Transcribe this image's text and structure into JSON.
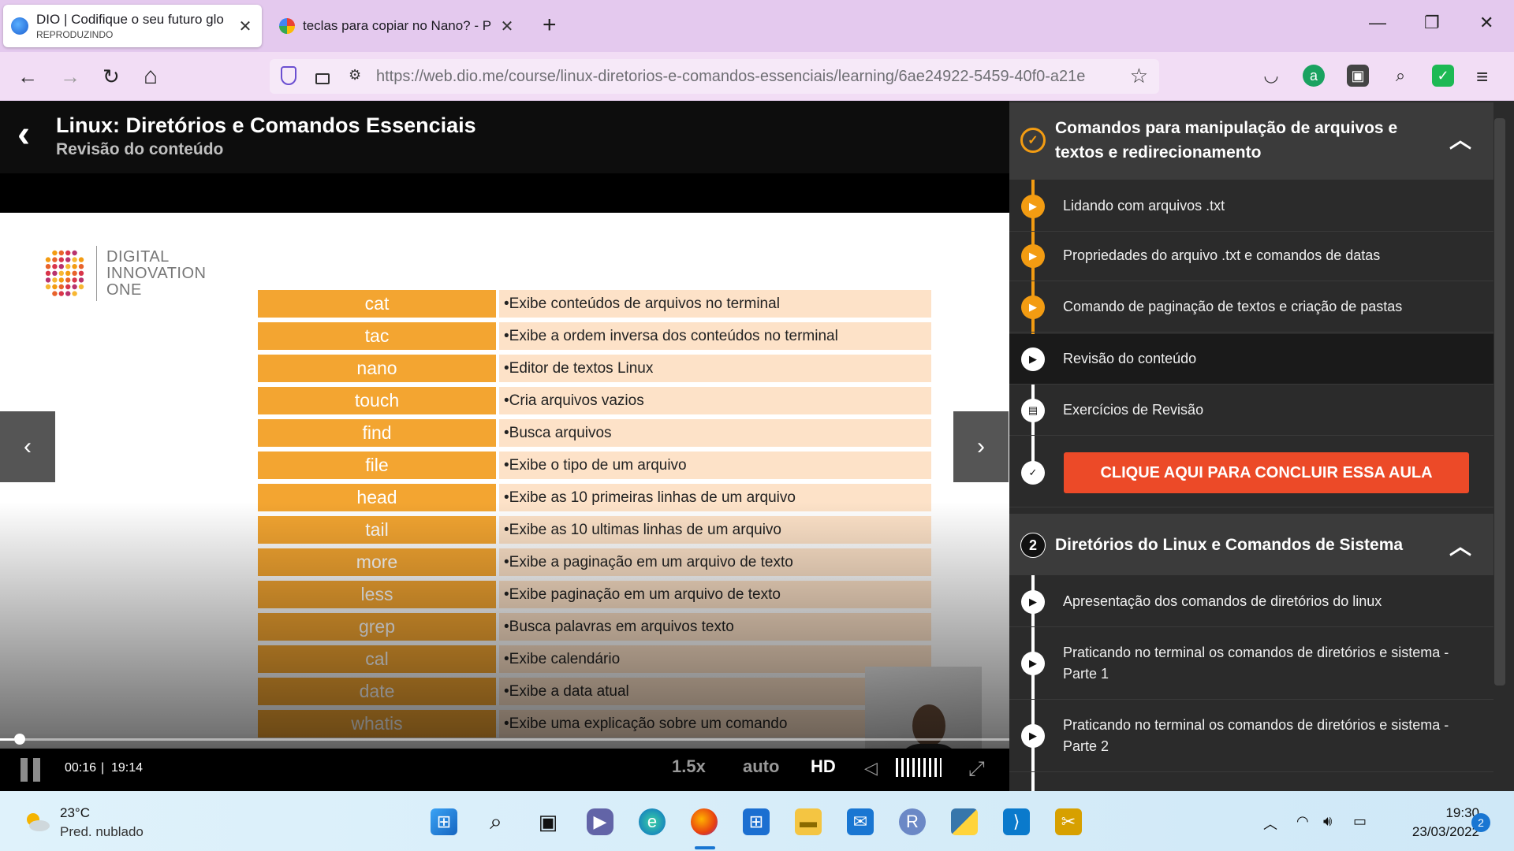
{
  "browser": {
    "tabs": [
      {
        "title": "DIO | Codifique o seu futuro glo",
        "subtitle": "REPRODUZINDO",
        "close": "✕"
      },
      {
        "title": "teclas para copiar no Nano? - P",
        "close": "✕"
      }
    ],
    "new_tab": "+",
    "window_controls": {
      "minimize": "—",
      "restore": "❐",
      "close": "✕"
    },
    "nav": {
      "back": "←",
      "forward": "→",
      "reload": "↻",
      "home": "⌂"
    },
    "url": "https://web.dio.me/course/linux-diretorios-e-comandos-essenciais/learning/6ae24922-5459-40f0-a21e",
    "menu": "≡"
  },
  "course": {
    "back": "‹",
    "title": "Linux: Diretórios e Comandos Essenciais",
    "lesson": "Revisão do conteúdo"
  },
  "slide": {
    "logo_text": [
      "DIGITAL",
      "INNOVATION",
      "ONE"
    ],
    "commands": [
      {
        "name": "cat",
        "desc": "•Exibe conteúdos de arquivos no terminal"
      },
      {
        "name": "tac",
        "desc": "•Exibe a ordem inversa dos conteúdos no terminal"
      },
      {
        "name": "nano",
        "desc": "•Editor de textos Linux"
      },
      {
        "name": "touch",
        "desc": "•Cria arquivos vazios"
      },
      {
        "name": "find",
        "desc": "•Busca arquivos"
      },
      {
        "name": "file",
        "desc": "•Exibe o tipo de um arquivo"
      },
      {
        "name": "head",
        "desc": "•Exibe as 10 primeiras linhas de um arquivo"
      },
      {
        "name": "tail",
        "desc": "•Exibe as 10 ultimas linhas de um arquivo"
      },
      {
        "name": "more",
        "desc": "•Exibe a paginação em um arquivo de texto"
      },
      {
        "name": "less",
        "desc": "•Exibe paginação em um arquivo de texto"
      },
      {
        "name": "grep",
        "desc": "•Busca palavras em arquivos texto"
      },
      {
        "name": "cal",
        "desc": "•Exibe calendário"
      },
      {
        "name": "date",
        "desc": "•Exibe a data atual"
      },
      {
        "name": "whatis",
        "desc": "•Exibe uma explicação sobre um comando"
      }
    ],
    "colors": {
      "cmd_bg": "#f3a531",
      "desc_bg": "#fde2c8"
    }
  },
  "player": {
    "prev": "‹",
    "next": "›",
    "time_current": "00:16",
    "time_separator": "|",
    "time_duration": "19:14",
    "progress_fraction": 0.014,
    "speed": "1.5x",
    "quality_mode": "auto",
    "hd": "HD",
    "volume_icon": "◁",
    "fullscreen_icon": "⤢"
  },
  "sidebar": {
    "module1": {
      "title": "Comandos para manipulação de arquivos e textos e redirecionamento",
      "badge": "✓",
      "caret": "︿",
      "lessons": [
        {
          "title": "Lidando com arquivos .txt",
          "icon": "play-icon",
          "status": "done"
        },
        {
          "title": "Propriedades do arquivo .txt e comandos de datas",
          "icon": "play-icon",
          "status": "done"
        },
        {
          "title": "Comando de paginação de textos e criação de pastas",
          "icon": "play-icon",
          "status": "done"
        },
        {
          "title": "Revisão do conteúdo",
          "icon": "play-icon",
          "status": "current"
        },
        {
          "title": "Exercícios de Revisão",
          "icon": "document-icon",
          "status": "pending"
        }
      ],
      "conclude_button": "CLIQUE AQUI PARA CONCLUIR ESSA AULA"
    },
    "module2": {
      "number": "2",
      "title": "Diretórios do Linux e Comandos de Sistema",
      "caret": "︿",
      "lessons": [
        {
          "title": "Apresentação dos comandos de diretórios do linux"
        },
        {
          "title": "Praticando no terminal os comandos de diretórios e sistema - Parte 1"
        },
        {
          "title": "Praticando no terminal os comandos de diretórios e sistema - Parte 2"
        }
      ]
    },
    "colors": {
      "accent": "#f39c12",
      "conclude": "#ec4a28"
    }
  },
  "taskbar": {
    "weather_temp": "23°C",
    "weather_desc": "Pred. nublado",
    "apps": [
      "windows-start-icon",
      "search-icon",
      "task-view-icon",
      "chat-icon",
      "edge-icon",
      "firefox-icon",
      "store-icon",
      "file-explorer-icon",
      "mail-icon",
      "r-icon",
      "python-icon",
      "vscode-icon",
      "snipping-icon"
    ],
    "clock_time": "19:30",
    "clock_date": "23/03/2022",
    "notifications": "2"
  }
}
